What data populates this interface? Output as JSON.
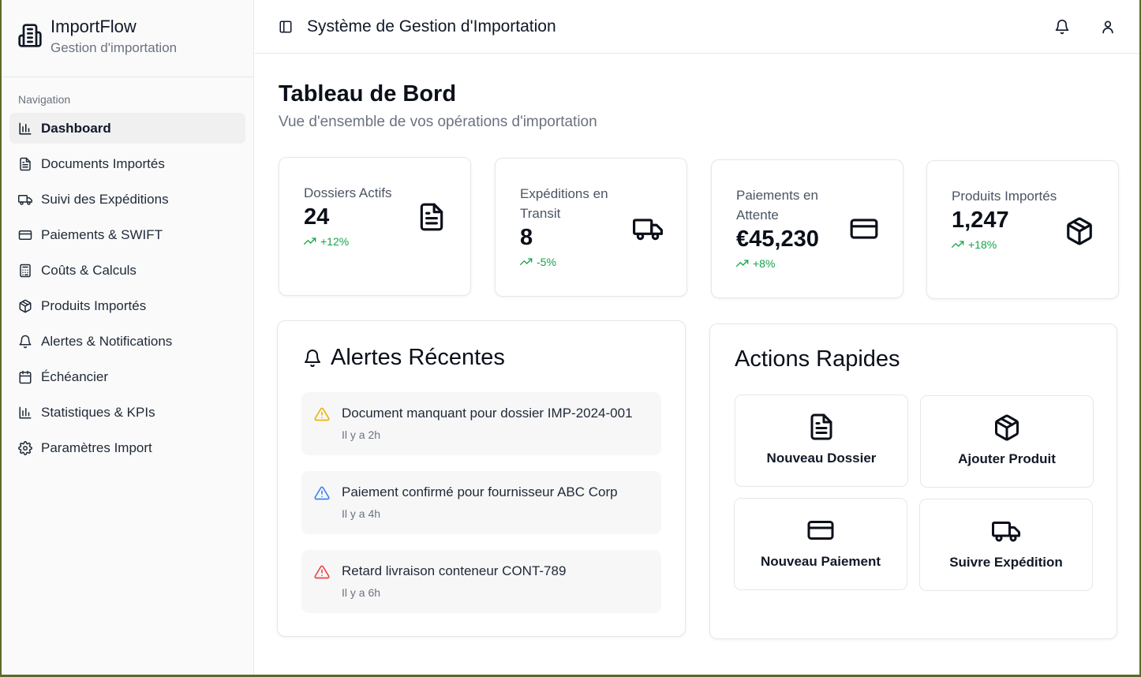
{
  "app": {
    "name": "ImportFlow",
    "subtitle": "Gestion d'importation"
  },
  "sidebar": {
    "section_label": "Navigation",
    "items": [
      {
        "label": "Dashboard",
        "icon": "bar-chart-icon",
        "active": true
      },
      {
        "label": "Documents Importés",
        "icon": "file-icon"
      },
      {
        "label": "Suivi des Expéditions",
        "icon": "truck-icon"
      },
      {
        "label": "Paiements & SWIFT",
        "icon": "credit-card-icon"
      },
      {
        "label": "Coûts & Calculs",
        "icon": "calculator-icon"
      },
      {
        "label": "Produits Importés",
        "icon": "package-icon"
      },
      {
        "label": "Alertes & Notifications",
        "icon": "bell-icon"
      },
      {
        "label": "Échéancier",
        "icon": "calendar-icon"
      },
      {
        "label": "Statistiques & KPIs",
        "icon": "bar-chart-icon"
      },
      {
        "label": "Paramètres Import",
        "icon": "gear-icon"
      }
    ]
  },
  "header": {
    "title": "Système de Gestion d'Importation"
  },
  "main": {
    "title": "Tableau de Bord",
    "subtitle": "Vue d'ensemble de vos opérations d'importation"
  },
  "stats": [
    {
      "label": "Dossiers Actifs",
      "value": "24",
      "trend": "+12%",
      "icon": "file-icon"
    },
    {
      "label": "Expéditions en Transit",
      "value": "8",
      "trend": "-5%",
      "icon": "truck-icon"
    },
    {
      "label": "Paiements en Attente",
      "value": "€45,230",
      "trend": "+8%",
      "icon": "credit-card-icon"
    },
    {
      "label": "Produits Importés",
      "value": "1,247",
      "trend": "+18%",
      "icon": "package-icon"
    }
  ],
  "alerts": {
    "title": "Alertes Récentes",
    "items": [
      {
        "message": "Document manquant pour dossier IMP-2024-001",
        "time": "Il y a 2h",
        "color": "#eab308"
      },
      {
        "message": "Paiement confirmé pour fournisseur ABC Corp",
        "time": "Il y a 4h",
        "color": "#3b82f6"
      },
      {
        "message": "Retard livraison conteneur CONT-789",
        "time": "Il y a 6h",
        "color": "#ef4444"
      }
    ]
  },
  "quick_actions": {
    "title": "Actions Rapides",
    "items": [
      {
        "label": "Nouveau Dossier",
        "icon": "file-icon"
      },
      {
        "label": "Ajouter Produit",
        "icon": "package-icon"
      },
      {
        "label": "Nouveau Paiement",
        "icon": "credit-card-icon"
      },
      {
        "label": "Suivre Expédition",
        "icon": "truck-icon"
      }
    ]
  },
  "colors": {
    "trend": "#16a34a",
    "active_bg": "#f0f0f0"
  }
}
